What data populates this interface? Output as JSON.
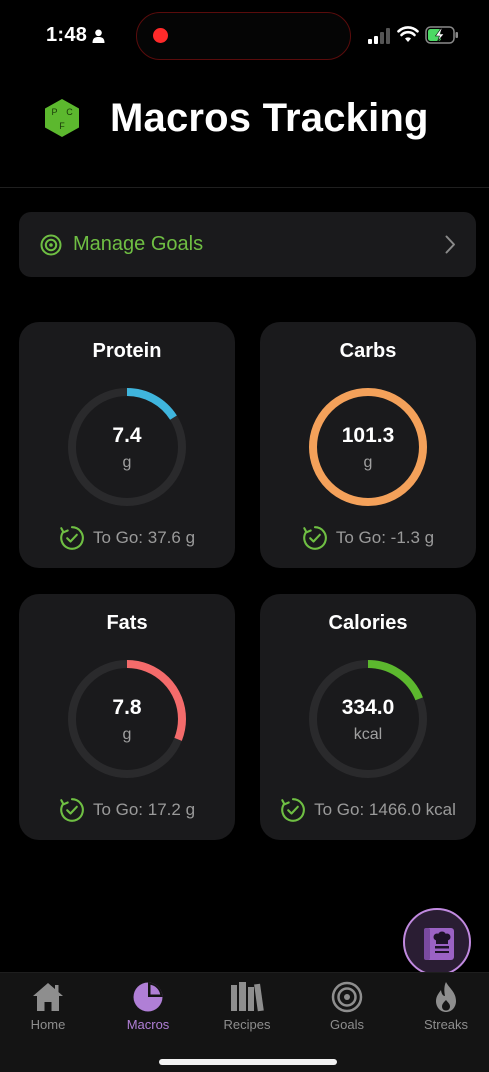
{
  "status_bar": {
    "time": "1:48"
  },
  "header": {
    "title": "Macros Tracking",
    "logo_letters": [
      "P",
      "C",
      "F"
    ]
  },
  "manage_goals": {
    "label": "Manage Goals"
  },
  "cards": [
    {
      "id": "protein",
      "title": "Protein",
      "value": "7.4",
      "unit": "g",
      "togo": "To Go: 37.6 g",
      "color": "#3fb5dd",
      "progress": 0.16
    },
    {
      "id": "carbs",
      "title": "Carbs",
      "value": "101.3",
      "unit": "g",
      "togo": "To Go: -1.3 g",
      "color": "#f4a15a",
      "progress": 1.0
    },
    {
      "id": "fats",
      "title": "Fats",
      "value": "7.8",
      "unit": "g",
      "togo": "To Go: 17.2 g",
      "color": "#f46b6b",
      "progress": 0.31
    },
    {
      "id": "calories",
      "title": "Calories",
      "value": "334.0",
      "unit": "kcal",
      "togo": "To Go: 1466.0 kcal",
      "color": "#5cb82e",
      "progress": 0.19
    }
  ],
  "tabs": [
    {
      "label": "Home",
      "icon": "house-icon",
      "active": false
    },
    {
      "label": "Macros",
      "icon": "pie-chart-icon",
      "active": true
    },
    {
      "label": "Recipes",
      "icon": "books-icon",
      "active": false
    },
    {
      "label": "Goals",
      "icon": "target-icon",
      "active": false
    },
    {
      "label": "Streaks",
      "icon": "flame-icon",
      "active": false
    }
  ],
  "colors": {
    "accent_green": "#6fbf43",
    "accent_purple": "#b07fd6",
    "card_bg": "#1a1a1c"
  }
}
